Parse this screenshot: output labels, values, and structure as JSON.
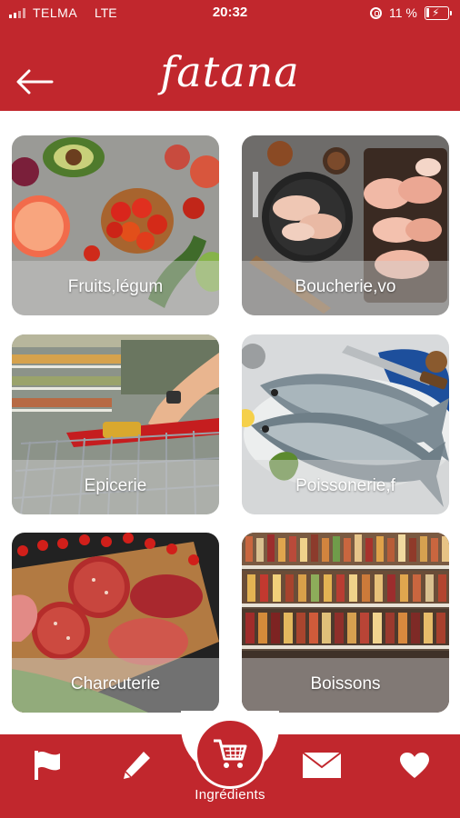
{
  "status_bar": {
    "carrier": "TELMA",
    "network": "LTE",
    "time": "20:32",
    "battery": "11 %"
  },
  "header": {
    "back_icon": "arrow-left-icon",
    "logo_text": "fatana"
  },
  "categories": [
    {
      "label": "Fruits,légum",
      "image": "fruits-vegetables-photo"
    },
    {
      "label": "Boucherie,vo",
      "image": "raw-meat-poultry-photo"
    },
    {
      "label": "Epicerie",
      "image": "supermarket-cart-aisle-photo"
    },
    {
      "label": "Poissonerie,f",
      "image": "fresh-fish-photo"
    },
    {
      "label": "Charcuterie",
      "image": "cured-meats-board-photo"
    },
    {
      "label": "Boissons",
      "image": "drinks-shelves-photo"
    }
  ],
  "bottom_nav": {
    "items": [
      "flag-icon",
      "pencil-icon",
      "cart-icon",
      "mail-icon",
      "heart-icon"
    ],
    "active_label": "Ingrédients"
  },
  "colors": {
    "brand_red": "#c1272d",
    "background": "#ffffff"
  }
}
